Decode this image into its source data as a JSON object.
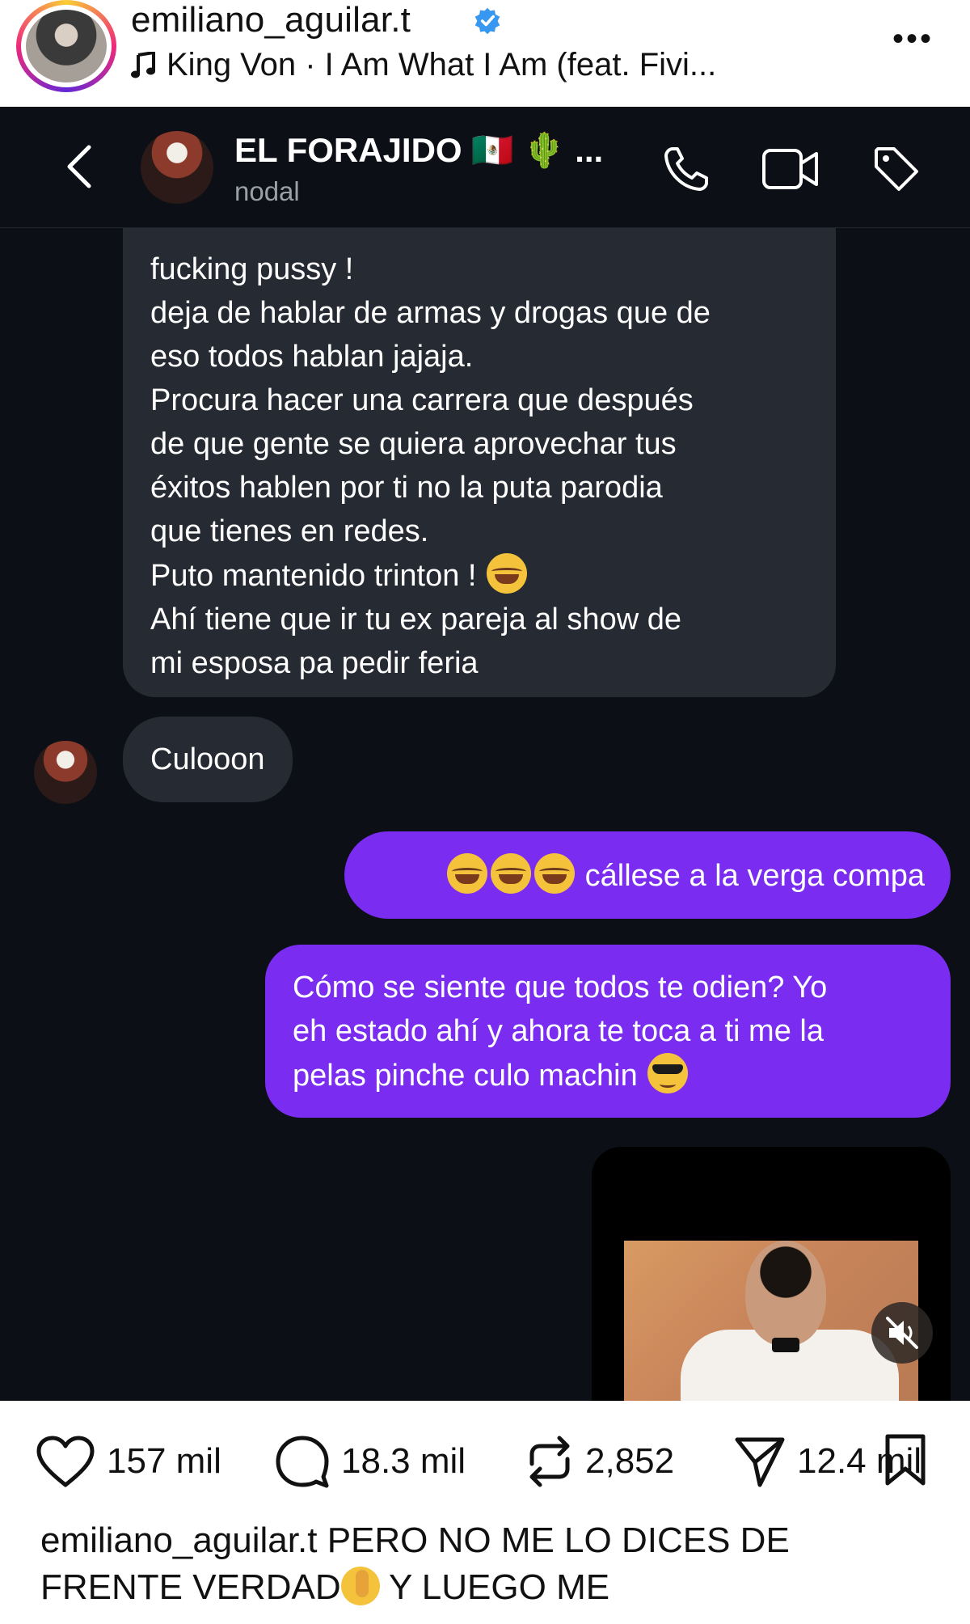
{
  "post": {
    "username": "emiliano_aguilar.t",
    "song": "King Von · I Am What I Am (feat. Fivi...",
    "more_icon": "more-horizontal-icon"
  },
  "dm": {
    "chat_name": "EL FORAJIDO 🇲🇽 🌵 ...",
    "chat_subtitle": "nodal",
    "incoming_long": [
      "fucking pussy !",
      "deja de hablar de armas y drogas que de",
      "eso todos hablan jajaja.",
      "Procura hacer una carrera que después",
      "de que gente se quiera aprovechar tus",
      "éxitos hablen por ti no la puta parodia",
      "que tienes en redes.",
      "Puto mantenido trinton !",
      "Ahí tiene que ir tu ex pareja al show de",
      "mi esposa pa pedir feria"
    ],
    "incoming_short": "Culooon",
    "outgoing_1": "cállese a la verga compa",
    "outgoing_2": [
      "Cómo se siente que todos te odien? Yo",
      "eh estado ahí y ahora te toca a ti me la",
      "pelas pinche culo machin"
    ]
  },
  "actions": {
    "likes": "157 mil",
    "comments": "18.3 mil",
    "reposts": "2,852",
    "shares": "12.4 mil"
  },
  "caption": {
    "username": "emiliano_aguilar.t",
    "text_1": "PERO NO ME LO DICES DE",
    "text_2": "FRENTE VERDAD",
    "text_3": " Y LUEGO ME"
  },
  "colors": {
    "dm_background": "#0c0f16",
    "incoming_bubble": "#262a33",
    "outgoing_bubble": "#7a2cf0",
    "verified_blue": "#3897f0"
  }
}
